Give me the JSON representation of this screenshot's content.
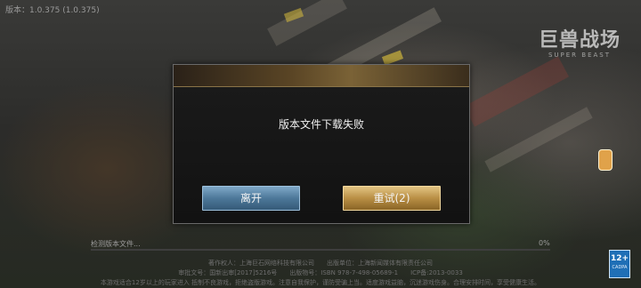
{
  "version_text": "版本：1.0.375 (1.0.375)",
  "logo": {
    "title": "巨兽战场",
    "subtitle": "SUPER BEAST"
  },
  "dialog": {
    "message": "版本文件下载失败",
    "leave_label": "离开",
    "retry_label": "重试(2)"
  },
  "progress": {
    "label": "检测版本文件...",
    "percent_text": "0%",
    "value": 0
  },
  "footer": {
    "line1": "著作权人：上海巨石网络科技有限公司　　出版单位：上海新闻媒体有限责任公司",
    "line2": "审批文号：国新出审[2017]5216号　　出版物号：ISBN 978-7-498-05689-1　　ICP备:2013-0033",
    "line3": "本游戏适合12岁以上的玩家进入 抵制不良游戏，拒绝盗版游戏。注意自我保护，谨防受骗上当。适度游戏益脑，沉迷游戏伤身。合理安排时间，享受健康生活。"
  },
  "age_rating": {
    "number": "12+",
    "caption": "CADPA"
  }
}
